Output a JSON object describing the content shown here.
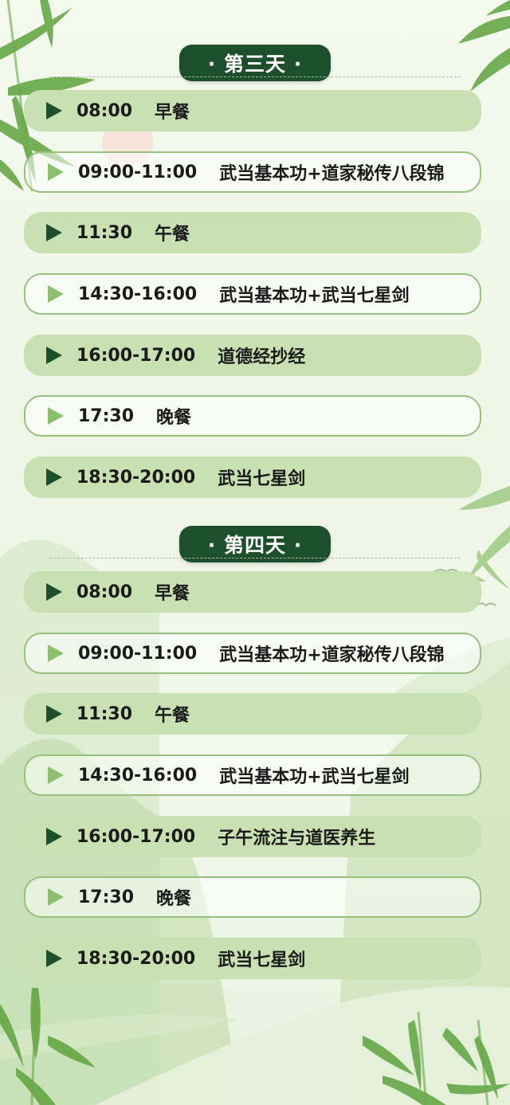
{
  "days": [
    {
      "title": "· 第三天 ·",
      "items": [
        {
          "time": "08:00",
          "activity": "早餐"
        },
        {
          "time": "09:00-11:00",
          "activity": "武当基本功+道家秘传八段锦"
        },
        {
          "time": "11:30",
          "activity": "午餐"
        },
        {
          "time": "14:30-16:00",
          "activity": "武当基本功+武当七星剑"
        },
        {
          "time": "16:00-17:00",
          "activity": "道德经抄经"
        },
        {
          "time": "17:30",
          "activity": "晚餐"
        },
        {
          "time": "18:30-20:00",
          "activity": "武当七星剑"
        }
      ]
    },
    {
      "title": "· 第四天 ·",
      "items": [
        {
          "time": "08:00",
          "activity": "早餐"
        },
        {
          "time": "09:00-11:00",
          "activity": "武当基本功+道家秘传八段锦"
        },
        {
          "time": "11:30",
          "activity": "午餐"
        },
        {
          "time": "14:30-16:00",
          "activity": "武当基本功+武当七星剑"
        },
        {
          "time": "16:00-17:00",
          "activity": "子午流注与道医养生"
        },
        {
          "time": "17:30",
          "activity": "晚餐"
        },
        {
          "time": "18:30-20:00",
          "activity": "武当七星剑"
        }
      ]
    }
  ],
  "colors": {
    "pill": "#1d4f2c",
    "filled_row": "#c9e0b2",
    "outline_row": "#97c07f",
    "arrow_dark": "#1d4f2c",
    "arrow_light": "#8cc06d"
  }
}
